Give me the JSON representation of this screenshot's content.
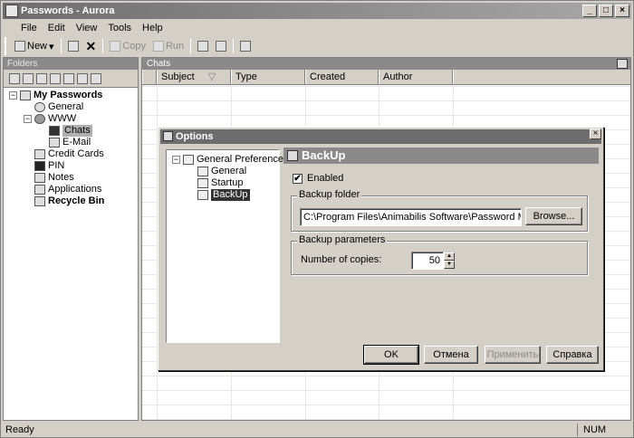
{
  "window": {
    "title": "Passwords - Aurora"
  },
  "menu": [
    "File",
    "Edit",
    "View",
    "Tools",
    "Help"
  ],
  "toolbar": {
    "new_label": "New",
    "copy_label": "Copy",
    "run_label": "Run"
  },
  "folders": {
    "header": "Folders",
    "tree": [
      {
        "label": "My Passwords",
        "icon": "home-icon",
        "bold": true
      },
      {
        "label": "General",
        "icon": "check-circle-icon"
      },
      {
        "label": "WWW",
        "icon": "globe-icon"
      },
      {
        "label": "Chats",
        "icon": "chat-window-icon",
        "selected": true
      },
      {
        "label": "E-Mail",
        "icon": "email-icon"
      },
      {
        "label": "Credit Cards",
        "icon": "credit-card-icon"
      },
      {
        "label": "PIN",
        "icon": "pin-icon"
      },
      {
        "label": "Notes",
        "icon": "notes-icon"
      },
      {
        "label": "Applications",
        "icon": "applications-icon"
      },
      {
        "label": "Recycle Bin",
        "icon": "recycle-bin-icon",
        "bold": true
      }
    ]
  },
  "list": {
    "header": "Chats",
    "columns": [
      "Subject",
      "Type",
      "Created",
      "Author"
    ]
  },
  "status": {
    "text": "Ready",
    "num": "NUM"
  },
  "dialog": {
    "title": "Options",
    "tree": [
      {
        "label": "General Preferences"
      },
      {
        "label": "General"
      },
      {
        "label": "Startup"
      },
      {
        "label": "BackUp",
        "selected": true
      }
    ],
    "panel_title": "BackUp",
    "enabled_label": "Enabled",
    "enabled_checked": "✔",
    "backup_folder_label": "Backup folder",
    "backup_folder_value": "C:\\Program Files\\Animabilis Software\\Password Manager\\backup",
    "browse_label": "Browse...",
    "backup_params_label": "Backup parameters",
    "copies_label": "Number of copies:",
    "copies_value": "50",
    "ok_label": "OK",
    "cancel_label": "Отмена",
    "apply_label": "Применить",
    "help_label": "Справка"
  }
}
